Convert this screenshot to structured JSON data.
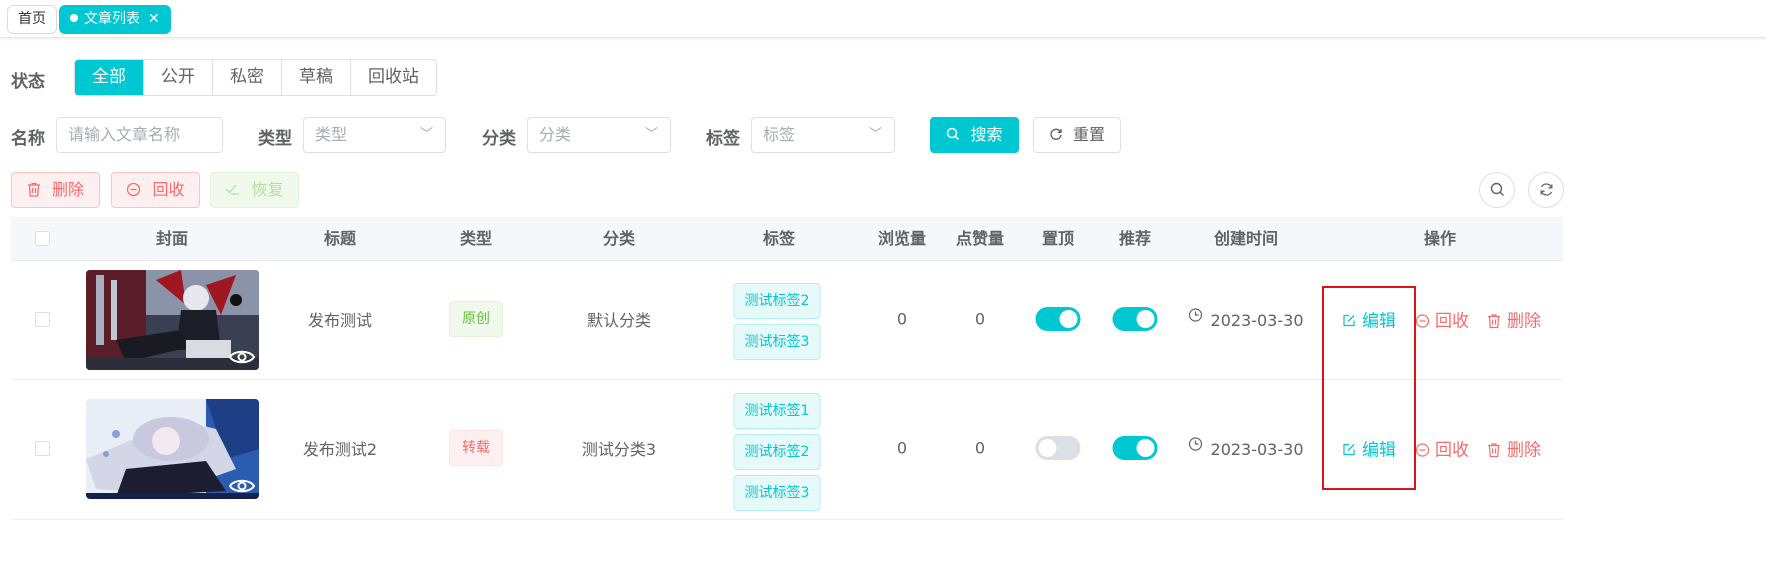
{
  "tabs": [
    {
      "label": "首页",
      "active": false
    },
    {
      "label": "文章列表",
      "active": true
    }
  ],
  "filters": {
    "status_label": "状态",
    "status_options": [
      "全部",
      "公开",
      "私密",
      "草稿",
      "回收站"
    ],
    "name_label": "名称",
    "name_placeholder": "请输入文章名称",
    "type_label": "类型",
    "type_placeholder": "类型",
    "category_label": "分类",
    "category_placeholder": "分类",
    "tag_label": "标签",
    "tag_placeholder": "标签",
    "search_button": "搜索",
    "reset_button": "重置"
  },
  "toolbar": {
    "delete_button": "删除",
    "recycle_button": "回收",
    "restore_button": "恢复"
  },
  "table": {
    "columns": [
      "封面",
      "标题",
      "类型",
      "分类",
      "标签",
      "浏览量",
      "点赞量",
      "置顶",
      "推荐",
      "创建时间",
      "操作"
    ],
    "rows": [
      {
        "title": "发布测试",
        "type": "原创",
        "category": "默认分类",
        "tags": [
          "测试标签2",
          "测试标签3"
        ],
        "views": "0",
        "likes": "0",
        "pinned": true,
        "recommended": true,
        "created": "2023-03-30"
      },
      {
        "title": "发布测试2",
        "type": "转载",
        "category": "测试分类3",
        "tags": [
          "测试标签1",
          "测试标签2",
          "测试标签3"
        ],
        "views": "0",
        "likes": "0",
        "pinned": false,
        "recommended": true,
        "created": "2023-03-30"
      }
    ],
    "actions": {
      "edit": "编辑",
      "recycle": "回收",
      "delete": "删除"
    }
  },
  "colors": {
    "accent": "#00c8d2",
    "danger": "#f56c6c",
    "success": "#67c23a",
    "highlight_box": "#e0101a"
  }
}
